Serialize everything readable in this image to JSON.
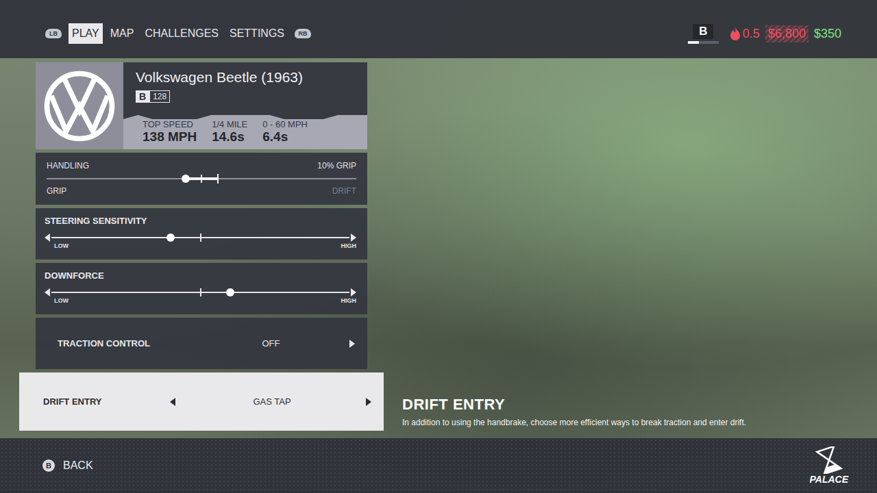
{
  "nav": {
    "left_bumper": "LB",
    "right_bumper": "RB",
    "tabs": [
      {
        "label": "PLAY",
        "selected": true
      },
      {
        "label": "MAP",
        "selected": false
      },
      {
        "label": "CHALLENGES",
        "selected": false
      },
      {
        "label": "SETTINGS",
        "selected": false
      }
    ]
  },
  "status": {
    "rank": "B",
    "rank_level": 0.35,
    "heat": "0.5",
    "wager": "$6,800",
    "cash": "$350"
  },
  "car": {
    "name": "Volkswagen Beetle (1963)",
    "class": "B",
    "rating": "128",
    "stats": [
      {
        "label": "TOP SPEED",
        "value": "138 MPH"
      },
      {
        "label": "1/4 MILE",
        "value": "14.6s"
      },
      {
        "label": "0 - 60 MPH",
        "value": "6.4s"
      }
    ]
  },
  "settings": [
    {
      "kind": "handling",
      "label": "HANDLING",
      "reading": "10% GRIP",
      "level": 0.45,
      "ends": [
        {
          "text": "GRIP",
          "active": true
        },
        {
          "text": "DRIFT",
          "active": false
        }
      ]
    },
    {
      "kind": "slider",
      "label": "STEERING SENSITIVITY",
      "level": 0.4,
      "ends": [
        {
          "text": "LOW",
          "active": true
        },
        {
          "text": "HIGH",
          "active": true
        }
      ]
    },
    {
      "kind": "slider",
      "label": "DOWNFORCE",
      "level": 0.6,
      "ends": [
        {
          "text": "LOW",
          "active": true
        },
        {
          "text": "HIGH",
          "active": true
        }
      ]
    },
    {
      "kind": "option",
      "label": "TRACTION CONTROL",
      "value": "OFF",
      "selected": false
    },
    {
      "kind": "option",
      "label": "DRIFT ENTRY",
      "value": "GAS TAP",
      "selected": true
    }
  ],
  "help": {
    "title": "DRIFT ENTRY",
    "description": "In addition to using the handbrake, choose more efficient ways to break traction and enter drift."
  },
  "footer": {
    "back_button": "B",
    "back_label": "BACK",
    "brand": "PALACE"
  }
}
